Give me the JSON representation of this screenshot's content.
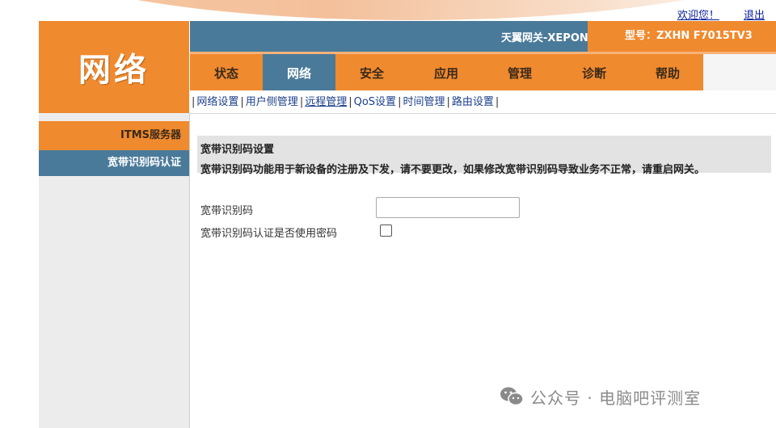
{
  "top_links": {
    "welcome": "欢迎您！",
    "logout": "退出"
  },
  "logo_text": "网络",
  "header": {
    "device_title": "天翼网关-XEPON",
    "model": "型号：ZXHN F7015TV3"
  },
  "nav": {
    "tabs": [
      "状态",
      "网络",
      "安全",
      "应用",
      "管理",
      "诊断",
      "帮助"
    ],
    "active_index": 1
  },
  "subnav": {
    "items": [
      "网络设置",
      "用户侧管理",
      "远程管理",
      "QoS设置",
      "时间管理",
      "路由设置"
    ],
    "active": "远程管理"
  },
  "sidebar": {
    "items": [
      "ITMS服务器",
      "宽带识别码认证"
    ]
  },
  "content": {
    "section_title": "宽带识别码设置",
    "section_desc": "宽带识别码功能用于新设备的注册及下发，请不要更改，如果修改宽带识别码导致业务不正常，请重启网关。",
    "field1_label": "宽带识别码",
    "field1_value": "",
    "field2_label": "宽带识别码认证是否使用密码"
  },
  "watermark": "公众号 · 电脑吧评测室",
  "colors": {
    "orange": "#f08a2e",
    "blue": "#4a7a99"
  }
}
